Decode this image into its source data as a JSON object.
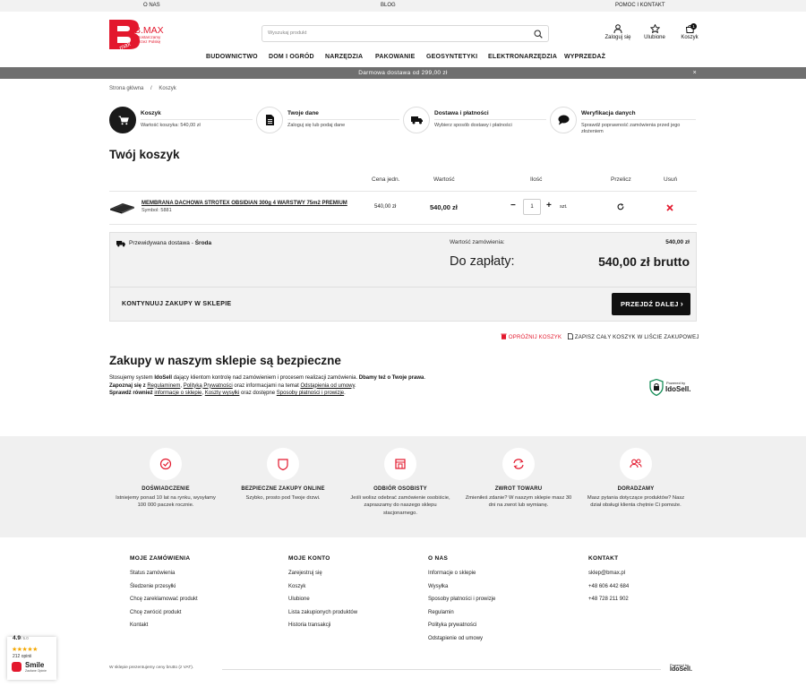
{
  "topbar": {
    "left": "O NAS",
    "center": "BLOG",
    "right": "POMOC I KONTAKT"
  },
  "logo": {
    "brand": "B.MAX",
    "tagline1": "Dostarczamy",
    "tagline2": "Przez Polskę",
    "side": "max"
  },
  "search": {
    "placeholder": "Wyszukaj produkt"
  },
  "header_icons": {
    "login": "Zaloguj się",
    "favorites": "Ulubione",
    "cart": "Koszyk",
    "cart_count": "1"
  },
  "nav": [
    "BUDOWNICTWO",
    "DOM I OGRÓD",
    "NARZĘDZIA",
    "PAKOWANIE",
    "GEOSYNTETYKI",
    "ELEKTRONARZĘDZIA",
    "WYPRZEDAŻ"
  ],
  "promo": {
    "text": "Darmowa dostawa od 299,00 zł",
    "close": "×"
  },
  "breadcrumb": {
    "home": "Strona główna",
    "sep": "/",
    "current": "Koszyk"
  },
  "steps": [
    {
      "title": "Koszyk",
      "desc": "Wartość koszyka: 540,00 zł",
      "icon": "cart-icon"
    },
    {
      "title": "Twoje dane",
      "desc": "Zaloguj się lub podaj dane",
      "icon": "document-icon"
    },
    {
      "title": "Dostawa i płatności",
      "desc": "Wybierz sposób dostawy i płatności",
      "icon": "truck-icon"
    },
    {
      "title": "Weryfikacja danych",
      "desc": "Sprawdź poprawność zamówienia przed jego złożeniem",
      "icon": "chat-icon"
    }
  ],
  "cart": {
    "title": "Twój koszyk",
    "headers": {
      "unit_price": "Cena jedn.",
      "value": "Wartość",
      "qty": "Ilość",
      "recalc": "Przelicz",
      "remove": "Usuń"
    },
    "item": {
      "name": "MEMBRANA DACHOWA STROTEX OBSIDIAN 300g 4 WARSTWY 75m2 PREMIUM",
      "symbol": "Symbol: 5881",
      "unit_price": "540,00 zł",
      "value": "540,00 zł",
      "qty": "1",
      "unit": "szt.",
      "minus": "−",
      "plus": "+"
    }
  },
  "summary": {
    "delivery_label": "Przewidywana dostawa -",
    "delivery_day": "Środa",
    "order_value_label": "Wartość zamówienia:",
    "order_value": "540,00 zł",
    "to_pay_label": "Do zapłaty:",
    "to_pay": "540,00 zł brutto",
    "continue": "KONTYNUUJ ZAKUPY W SKLEPIE",
    "next": "PRZEJDŹ DALEJ"
  },
  "actions": {
    "empty": "OPRÓŻNIJ KOSZYK",
    "save": "ZAPISZ CAŁY KOSZYK W LIŚCIE ZAKUPOWEJ"
  },
  "safe": {
    "title": "Zakupy w naszym sklepie są bezpieczne",
    "l1a": "Stosujemy system ",
    "l1b": "IdoSell",
    "l1c": " dający klientom kontrolę nad zamówieniem i procesem realizacji zamówienia. ",
    "l1d": "Dbamy też o Twoje prawa",
    "l2a": "Zapoznaj się z ",
    "l2b": "Regulaminem",
    "l2c": "Polityką Prywatności",
    "l2d": " oraz informacjami na temat ",
    "l2e": "Odstąpienia od umowy",
    "l3a": "Sprawdź również ",
    "l3b": "informacje o sklepie",
    "l3c": "Koszty wysyłki",
    "l3d": " oraz dostępne ",
    "l3e": "Sposoby płatności i prowizje",
    "badge_small": "Powered by",
    "badge_brand": "IdoSell."
  },
  "features": [
    {
      "title": "DOŚWIADCZENIE",
      "desc": "Istniejemy ponad 10 lat na rynku, wysyłamy 100 000 paczek rocznie."
    },
    {
      "title": "BEZPIECZNE ZAKUPY ONLINE",
      "desc": "Szybko, prosto pod Twoje drzwi."
    },
    {
      "title": "ODBIÓR OSOBISTY",
      "desc": "Jeśli wolisz odebrać zamówienie osobiście, zapraszamy do naszego sklepu stacjonarnego."
    },
    {
      "title": "ZWROT TOWARU",
      "desc": "Zmieniłeś zdanie? W naszym sklepie masz 30 dni na zwrot lub wymianę."
    },
    {
      "title": "DORADZAMY",
      "desc": "Masz pytania dotyczące produktów? Nasz dział obsługi klienta chętnie Ci pomoże."
    }
  ],
  "footer": [
    {
      "heading": "MOJE ZAMÓWIENIA",
      "items": [
        "Status zamówienia",
        "Śledzenie przesyłki",
        "Chcę zareklamować produkt",
        "Chcę zwrócić produkt",
        "Kontakt"
      ]
    },
    {
      "heading": "MOJE KONTO",
      "items": [
        "Zarejestruj się",
        "Koszyk",
        "Ulubione",
        "Lista zakupionych produktów",
        "Historia transakcji"
      ]
    },
    {
      "heading": "O NAS",
      "items": [
        "Informacje o sklepie",
        "Wysyłka",
        "Sposoby płatności i prowizje",
        "Regulamin",
        "Polityka prywatności",
        "Odstąpienie od umowy"
      ]
    },
    {
      "heading": "KONTAKT",
      "items": [
        "sklep@bmax.pl",
        "+48 606 442 684",
        "+48 728 211 902"
      ]
    }
  ],
  "rating": {
    "score": "4.9",
    "of": "/ 5.0",
    "count": "212 opinii",
    "brand": "Smile",
    "brand_sub": "Zaufane Opinie"
  },
  "bottom": {
    "note": "W sklepie prezentujemy ceny brutto (z VAT).",
    "powered": "Powered by",
    "brand": "IdoSell."
  },
  "colors": {
    "accent": "#e3182d",
    "dark": "#111111",
    "gray_bar": "#6f6f6f"
  }
}
